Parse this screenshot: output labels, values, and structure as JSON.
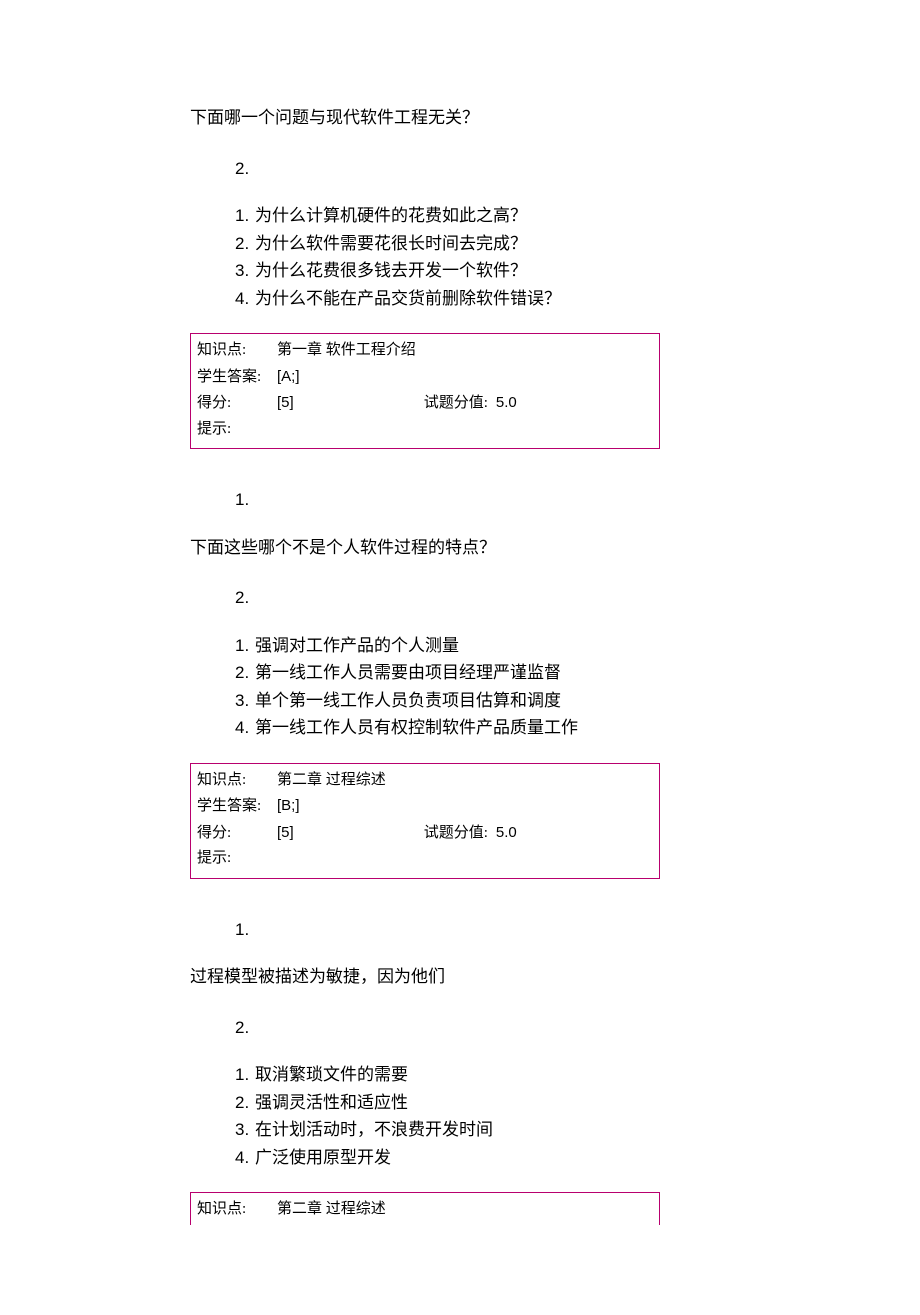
{
  "questions": [
    {
      "stem": "下面哪一个问题与现代软件工程无关？",
      "sub_number": "2.",
      "options": [
        {
          "num": "1.",
          "text": "为什么计算机硬件的花费如此之高？"
        },
        {
          "num": "2.",
          "text": "为什么软件需要花很长时间去完成？"
        },
        {
          "num": "3.",
          "text": "为什么花费很多钱去开发一个软件？"
        },
        {
          "num": "4.",
          "text": "为什么不能在产品交货前删除软件错误？"
        }
      ],
      "meta": {
        "knowledge_label": "知识点:",
        "knowledge_value": "第一章  软件工程介绍",
        "student_answer_label": "学生答案:",
        "student_answer_value": "[A;]",
        "score_label": "得分:",
        "score_value": "[5]",
        "full_label": "试题分值:",
        "full_value": "5.0",
        "hint_label": "提示:",
        "hint_value": ""
      },
      "lead_number": ""
    },
    {
      "lead_number": "1.",
      "stem": "下面这些哪个不是个人软件过程的特点？",
      "sub_number": "2.",
      "options": [
        {
          "num": "1.",
          "text": "强调对工作产品的个人测量"
        },
        {
          "num": "2.",
          "text": "第一线工作人员需要由项目经理严谨监督"
        },
        {
          "num": "3.",
          "text": "单个第一线工作人员负责项目估算和调度"
        },
        {
          "num": "4.",
          "text": "第一线工作人员有权控制软件产品质量工作"
        }
      ],
      "meta": {
        "knowledge_label": "知识点:",
        "knowledge_value": "第二章  过程综述",
        "student_answer_label": "学生答案:",
        "student_answer_value": "[B;]",
        "score_label": "得分:",
        "score_value": "[5]",
        "full_label": "试题分值:",
        "full_value": "5.0",
        "hint_label": "提示:",
        "hint_value": ""
      }
    },
    {
      "lead_number": "1.",
      "stem": "过程模型被描述为敏捷，因为他们",
      "sub_number": "2.",
      "options": [
        {
          "num": "1.",
          "text": "取消繁琐文件的需要"
        },
        {
          "num": "2.",
          "text": "强调灵活性和适应性"
        },
        {
          "num": "3.",
          "text": "在计划活动时，不浪费开发时间"
        },
        {
          "num": "4.",
          "text": "广泛使用原型开发"
        }
      ],
      "meta": {
        "knowledge_label": "知识点:",
        "knowledge_value": "第二章  过程综述",
        "student_answer_label": "",
        "student_answer_value": "",
        "score_label": "",
        "score_value": "",
        "full_label": "",
        "full_value": "",
        "hint_label": "",
        "hint_value": ""
      },
      "meta_truncated": true
    }
  ]
}
